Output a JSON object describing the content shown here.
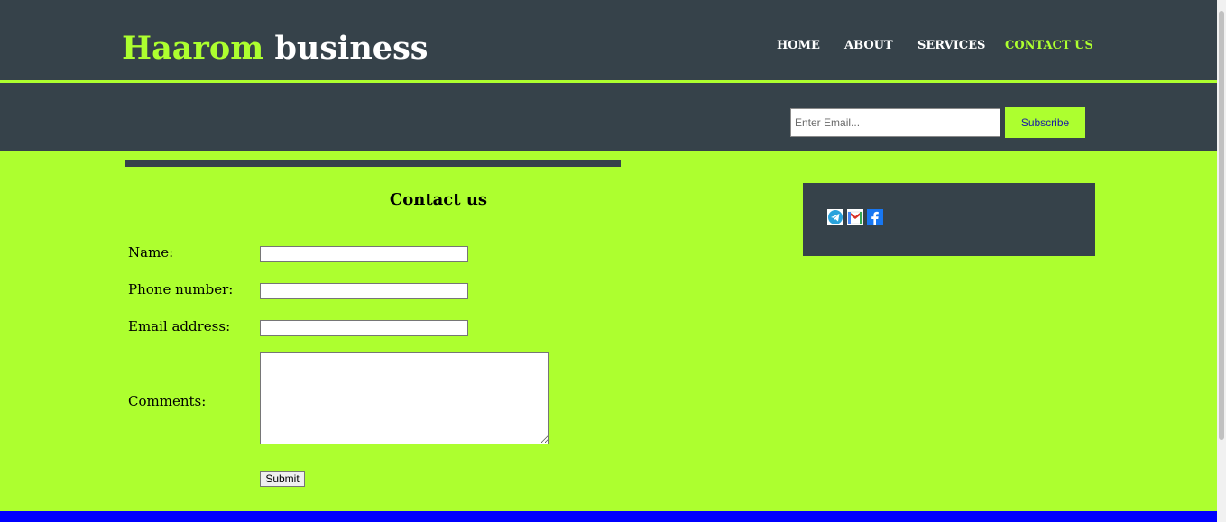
{
  "brand": {
    "part1": "Haarom",
    "part2": "business"
  },
  "nav": [
    {
      "label": "HOME",
      "active": false
    },
    {
      "label": "ABOUT",
      "active": false
    },
    {
      "label": "SERVICES",
      "active": false
    },
    {
      "label": "CONTACT US",
      "active": true
    }
  ],
  "subscribe": {
    "placeholder": "Enter Email...",
    "button": "Subscribe"
  },
  "contact": {
    "title": "Contact us",
    "name_label": "Name:",
    "phone_label": "Phone number:",
    "email_label": "Email address:",
    "comments_label": "Comments:",
    "submit": "Submit"
  },
  "social": [
    "telegram-icon",
    "gmail-icon",
    "facebook-icon"
  ],
  "colors": {
    "accent": "#adff2f",
    "dark": "#36424a",
    "footer": "#0000ff"
  }
}
